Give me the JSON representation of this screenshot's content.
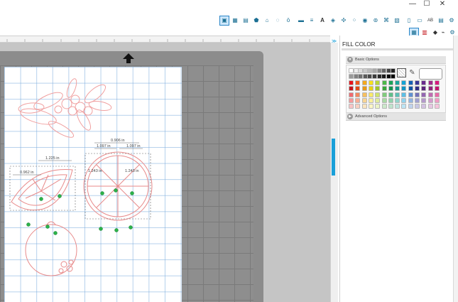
{
  "window": {
    "minimize_glyph": "—",
    "maximize_glyph": "☐",
    "close_glyph": "✕"
  },
  "toolbar": {
    "row1": [
      "design-page-icon",
      "grid-icon",
      "ruler-icon",
      "pentagon-icon",
      "home-icon",
      "shapes-icon",
      "apple-icon",
      "fill-pattern-icon",
      "line-style-icon",
      "text-icon",
      "transform-icon",
      "align-icon",
      "replicate-icon",
      "weld-icon",
      "offset-icon",
      "trace-icon",
      "image-icon",
      "library-icon",
      "text-style-icon",
      "send-icon",
      "settings-icon"
    ],
    "text_icon_label": "A",
    "textstyle_label": "AB",
    "row2": [
      "fill-color-icon",
      "line-color-icon",
      "eraser-icon",
      "knife-icon",
      "gear-icon"
    ]
  },
  "panel": {
    "title": "FILL COLOR",
    "basic_options": "Basic Options",
    "advanced_options": "Advanced Options",
    "expand_glyph": "≫"
  },
  "palette": {
    "grays": [
      "#ffffff",
      "#eeeeee",
      "#dddddd",
      "#cccccc",
      "#bbbbbb",
      "#aaaaaa",
      "#888888",
      "#666666",
      "#444444",
      "#222222"
    ],
    "dark_grays": [
      "#999999",
      "#808080",
      "#707070",
      "#5a5a5a",
      "#4a4a4a",
      "#3a3a3a",
      "#2a2a2a",
      "#1a1a1a",
      "#0a0a0a",
      "#000000"
    ],
    "row_colors": [
      [
        "#e8131b",
        "#f0561c",
        "#f5a91c",
        "#f7e11c",
        "#b7d833",
        "#4cb848",
        "#1ba35a",
        "#19a79b",
        "#14a3d6",
        "#1561b5",
        "#3a3797",
        "#6a2b8e",
        "#a12a8b",
        "#d8197d"
      ],
      [
        "#c5151b",
        "#e04a17",
        "#e89a17",
        "#e8d117",
        "#9fc62b",
        "#3aa63c",
        "#17934f",
        "#15958b",
        "#1294c4",
        "#1254a3",
        "#322f85",
        "#5c257c",
        "#8e257a",
        "#c2156e"
      ],
      [
        "#f06a6e",
        "#f4895f",
        "#f7c05f",
        "#f9ea69",
        "#cfe46d",
        "#80cc7c",
        "#5fbf8b",
        "#5cc0b6",
        "#5cc0e6",
        "#6091d2",
        "#7472b9",
        "#9467b2",
        "#c06bb1",
        "#e86aa8"
      ],
      [
        "#f59a9c",
        "#f7ae94",
        "#f9d594",
        "#fbf09c",
        "#dfec9d",
        "#a9daa4",
        "#93d2ae",
        "#91d3cb",
        "#91d4ef",
        "#93b4e0",
        "#a09fcf",
        "#b499cb",
        "#d39ccb",
        "#f09bc4"
      ],
      [
        "#f8c3c4",
        "#f9cfc0",
        "#fbe5c0",
        "#fcf6c5",
        "#ecf4c5",
        "#cbe8ca",
        "#bfe3cc",
        "#bde4df",
        "#bde5f5",
        "#bfd2ec",
        "#c8c7e4",
        "#d3c2e2",
        "#e6c5e2",
        "#f6c4dc"
      ]
    ]
  },
  "canvas": {
    "dimensions": [
      {
        "text": "0.906 in"
      },
      {
        "text": "1.097 in"
      },
      {
        "text": "1.097 in"
      },
      {
        "text": "1.225 in"
      },
      {
        "text": "0.962 in"
      },
      {
        "text": "1.243 in"
      },
      {
        "text": "1.243 in"
      }
    ]
  }
}
